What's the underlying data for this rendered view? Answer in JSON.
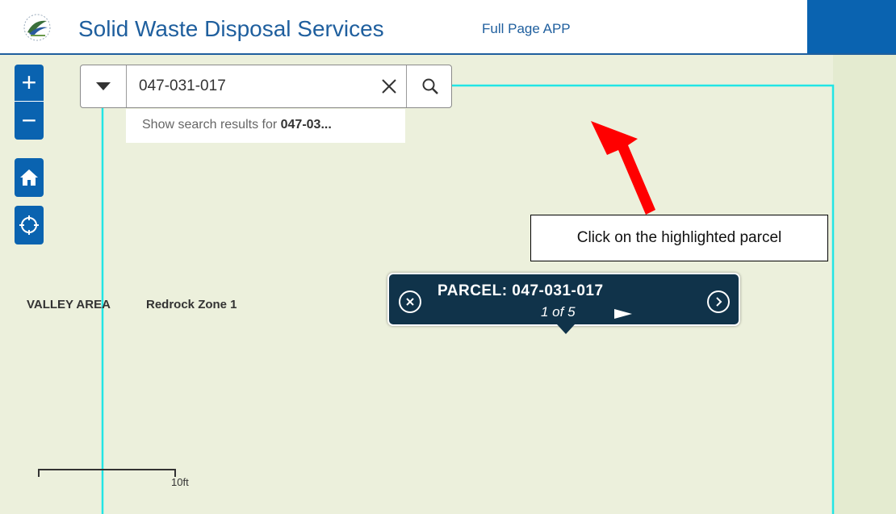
{
  "header": {
    "title": "Solid Waste Disposal Services",
    "full_page_link": "Full Page APP",
    "logo_icon": "county-seal-logo",
    "accent_color": "#1f5f9e",
    "panel_color": "#0a63b0"
  },
  "map_controls": {
    "zoom_in": "+",
    "zoom_out": "−",
    "home_icon": "home-icon",
    "locate_icon": "locate-icon"
  },
  "search": {
    "value": "047-031-017",
    "dropdown_icon": "caret-down-icon",
    "clear_icon": "close-icon",
    "search_icon": "search-icon",
    "suggestion_prefix": "Show search results for ",
    "suggestion_bold": "047-03..."
  },
  "map_labels": {
    "area": "VALLEY AREA",
    "zone": "Redrock Zone 1"
  },
  "annotation": {
    "text": "Click on the highlighted parcel",
    "arrow_color": "#ff0000"
  },
  "popup": {
    "title": "PARCEL: 047-031-017",
    "count": "1 of 5",
    "close_icon": "close-circle-icon",
    "next_icon": "chevron-right-circle-icon",
    "play_icon": "next-feature-arrow-icon",
    "bg_color": "#10334a"
  },
  "scale": {
    "label": "10ft"
  },
  "colors": {
    "map_bg": "#ecf0dc",
    "parcel_highlight": "#22e5e5"
  }
}
